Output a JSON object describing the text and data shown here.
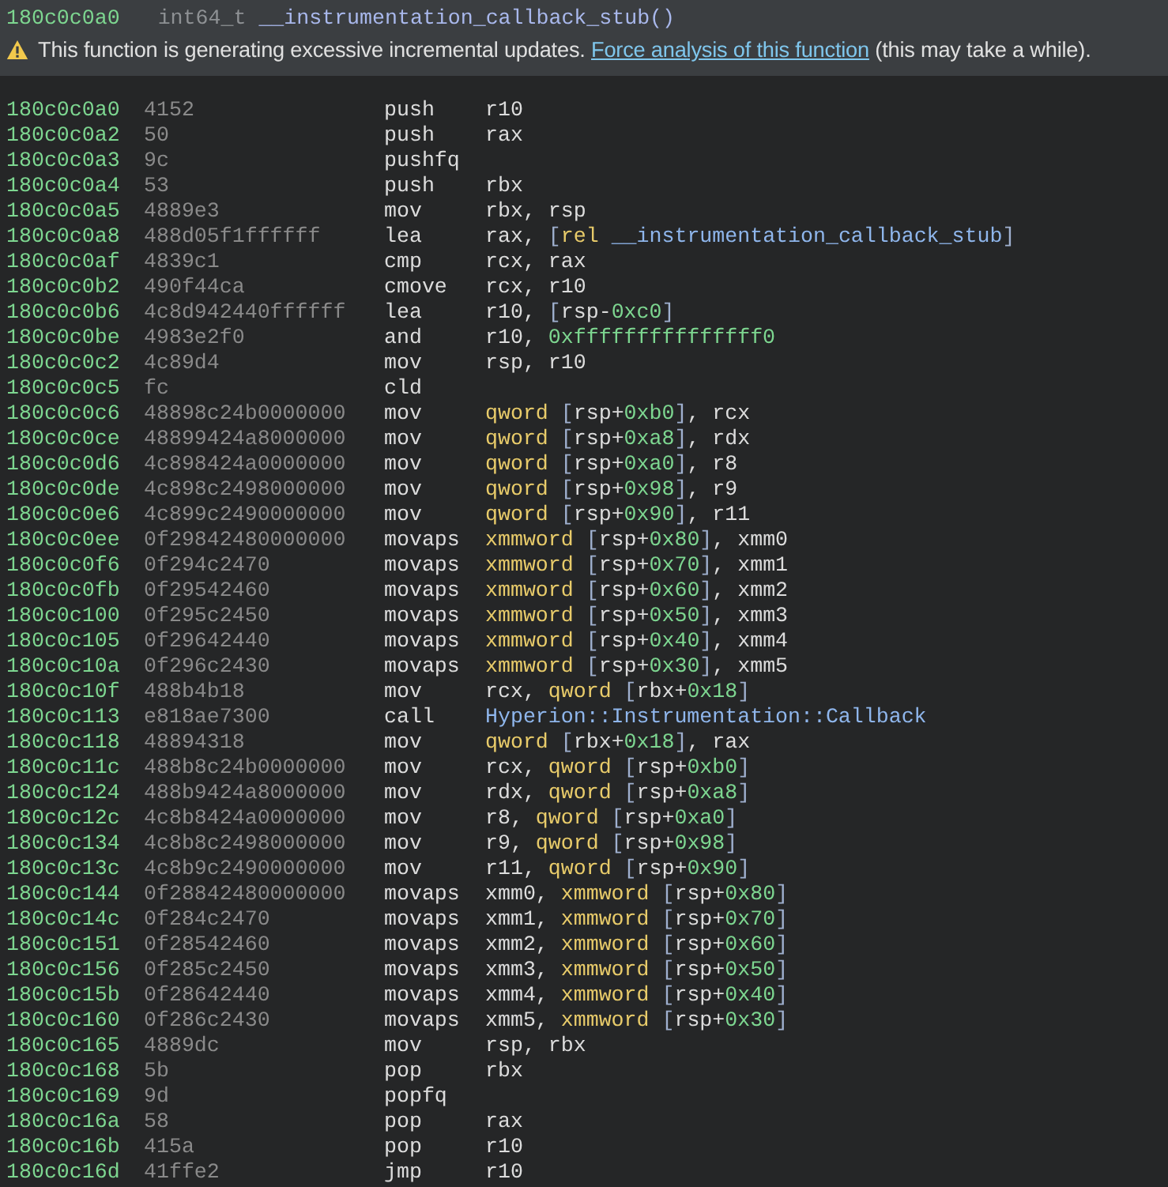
{
  "header": {
    "address": "180c0c0a0",
    "return_type": "int64_t",
    "function_name": "__instrumentation_callback_stub()"
  },
  "warning": {
    "before": "This function is generating excessive incremental updates. ",
    "link": "Force analysis of this function",
    "after": " (this may take a while)."
  },
  "instructions": [
    {
      "address": "180c0c0a0",
      "bytes": "4152",
      "mnemonic": "push",
      "operands": [
        {
          "kind": "reg",
          "text": "r10"
        }
      ]
    },
    {
      "address": "180c0c0a2",
      "bytes": "50",
      "mnemonic": "push",
      "operands": [
        {
          "kind": "reg",
          "text": "rax"
        }
      ]
    },
    {
      "address": "180c0c0a3",
      "bytes": "9c",
      "mnemonic": "pushfq"
    },
    {
      "address": "180c0c0a4",
      "bytes": "53",
      "mnemonic": "push",
      "operands": [
        {
          "kind": "reg",
          "text": "rbx"
        }
      ]
    },
    {
      "address": "180c0c0a5",
      "bytes": "4889e3",
      "mnemonic": "mov",
      "operands": [
        {
          "kind": "reg",
          "text": "rbx, rsp"
        }
      ]
    },
    {
      "address": "180c0c0a8",
      "bytes": "488d05f1ffffff",
      "mnemonic": "lea",
      "operands": [
        {
          "kind": "reg",
          "text": "rax, "
        },
        {
          "kind": "bracket",
          "text": "["
        },
        {
          "kind": "size",
          "text": "rel"
        },
        {
          "kind": "sym",
          "text": " __instrumentation_callback_stub"
        },
        {
          "kind": "bracket",
          "text": "]"
        }
      ]
    },
    {
      "address": "180c0c0af",
      "bytes": "4839c1",
      "mnemonic": "cmp",
      "operands": [
        {
          "kind": "reg",
          "text": "rcx, rax"
        }
      ]
    },
    {
      "address": "180c0c0b2",
      "bytes": "490f44ca",
      "mnemonic": "cmove",
      "operands": [
        {
          "kind": "reg",
          "text": "rcx, r10"
        }
      ]
    },
    {
      "address": "180c0c0b6",
      "bytes": "4c8d942440ffffff",
      "mnemonic": "lea",
      "operands": [
        {
          "kind": "reg",
          "text": "r10, "
        },
        {
          "kind": "bracket",
          "text": "["
        },
        {
          "kind": "reg",
          "text": "rsp-"
        },
        {
          "kind": "num",
          "text": "0xc0"
        },
        {
          "kind": "bracket",
          "text": "]"
        }
      ]
    },
    {
      "address": "180c0c0be",
      "bytes": "4983e2f0",
      "mnemonic": "and",
      "operands": [
        {
          "kind": "reg",
          "text": "r10, "
        },
        {
          "kind": "num",
          "text": "0xfffffffffffffff0"
        }
      ]
    },
    {
      "address": "180c0c0c2",
      "bytes": "4c89d4",
      "mnemonic": "mov",
      "operands": [
        {
          "kind": "reg",
          "text": "rsp, r10"
        }
      ]
    },
    {
      "address": "180c0c0c5",
      "bytes": "fc",
      "mnemonic": "cld"
    },
    {
      "address": "180c0c0c6",
      "bytes": "48898c24b0000000",
      "mnemonic": "mov",
      "operands": [
        {
          "kind": "size",
          "text": "qword"
        },
        {
          "kind": "bracket",
          "text": " ["
        },
        {
          "kind": "reg",
          "text": "rsp+"
        },
        {
          "kind": "num",
          "text": "0xb0"
        },
        {
          "kind": "bracket",
          "text": "]"
        },
        {
          "kind": "reg",
          "text": ", rcx"
        }
      ]
    },
    {
      "address": "180c0c0ce",
      "bytes": "48899424a8000000",
      "mnemonic": "mov",
      "operands": [
        {
          "kind": "size",
          "text": "qword"
        },
        {
          "kind": "bracket",
          "text": " ["
        },
        {
          "kind": "reg",
          "text": "rsp+"
        },
        {
          "kind": "num",
          "text": "0xa8"
        },
        {
          "kind": "bracket",
          "text": "]"
        },
        {
          "kind": "reg",
          "text": ", rdx"
        }
      ]
    },
    {
      "address": "180c0c0d6",
      "bytes": "4c898424a0000000",
      "mnemonic": "mov",
      "operands": [
        {
          "kind": "size",
          "text": "qword"
        },
        {
          "kind": "bracket",
          "text": " ["
        },
        {
          "kind": "reg",
          "text": "rsp+"
        },
        {
          "kind": "num",
          "text": "0xa0"
        },
        {
          "kind": "bracket",
          "text": "]"
        },
        {
          "kind": "reg",
          "text": ", r8"
        }
      ]
    },
    {
      "address": "180c0c0de",
      "bytes": "4c898c2498000000",
      "mnemonic": "mov",
      "operands": [
        {
          "kind": "size",
          "text": "qword"
        },
        {
          "kind": "bracket",
          "text": " ["
        },
        {
          "kind": "reg",
          "text": "rsp+"
        },
        {
          "kind": "num",
          "text": "0x98"
        },
        {
          "kind": "bracket",
          "text": "]"
        },
        {
          "kind": "reg",
          "text": ", r9"
        }
      ]
    },
    {
      "address": "180c0c0e6",
      "bytes": "4c899c2490000000",
      "mnemonic": "mov",
      "operands": [
        {
          "kind": "size",
          "text": "qword"
        },
        {
          "kind": "bracket",
          "text": " ["
        },
        {
          "kind": "reg",
          "text": "rsp+"
        },
        {
          "kind": "num",
          "text": "0x90"
        },
        {
          "kind": "bracket",
          "text": "]"
        },
        {
          "kind": "reg",
          "text": ", r11"
        }
      ]
    },
    {
      "address": "180c0c0ee",
      "bytes": "0f29842480000000",
      "mnemonic": "movaps",
      "operands": [
        {
          "kind": "size",
          "text": "xmmword"
        },
        {
          "kind": "bracket",
          "text": " ["
        },
        {
          "kind": "reg",
          "text": "rsp+"
        },
        {
          "kind": "num",
          "text": "0x80"
        },
        {
          "kind": "bracket",
          "text": "]"
        },
        {
          "kind": "reg",
          "text": ", xmm0"
        }
      ]
    },
    {
      "address": "180c0c0f6",
      "bytes": "0f294c2470",
      "mnemonic": "movaps",
      "operands": [
        {
          "kind": "size",
          "text": "xmmword"
        },
        {
          "kind": "bracket",
          "text": " ["
        },
        {
          "kind": "reg",
          "text": "rsp+"
        },
        {
          "kind": "num",
          "text": "0x70"
        },
        {
          "kind": "bracket",
          "text": "]"
        },
        {
          "kind": "reg",
          "text": ", xmm1"
        }
      ]
    },
    {
      "address": "180c0c0fb",
      "bytes": "0f29542460",
      "mnemonic": "movaps",
      "operands": [
        {
          "kind": "size",
          "text": "xmmword"
        },
        {
          "kind": "bracket",
          "text": " ["
        },
        {
          "kind": "reg",
          "text": "rsp+"
        },
        {
          "kind": "num",
          "text": "0x60"
        },
        {
          "kind": "bracket",
          "text": "]"
        },
        {
          "kind": "reg",
          "text": ", xmm2"
        }
      ]
    },
    {
      "address": "180c0c100",
      "bytes": "0f295c2450",
      "mnemonic": "movaps",
      "operands": [
        {
          "kind": "size",
          "text": "xmmword"
        },
        {
          "kind": "bracket",
          "text": " ["
        },
        {
          "kind": "reg",
          "text": "rsp+"
        },
        {
          "kind": "num",
          "text": "0x50"
        },
        {
          "kind": "bracket",
          "text": "]"
        },
        {
          "kind": "reg",
          "text": ", xmm3"
        }
      ]
    },
    {
      "address": "180c0c105",
      "bytes": "0f29642440",
      "mnemonic": "movaps",
      "operands": [
        {
          "kind": "size",
          "text": "xmmword"
        },
        {
          "kind": "bracket",
          "text": " ["
        },
        {
          "kind": "reg",
          "text": "rsp+"
        },
        {
          "kind": "num",
          "text": "0x40"
        },
        {
          "kind": "bracket",
          "text": "]"
        },
        {
          "kind": "reg",
          "text": ", xmm4"
        }
      ]
    },
    {
      "address": "180c0c10a",
      "bytes": "0f296c2430",
      "mnemonic": "movaps",
      "operands": [
        {
          "kind": "size",
          "text": "xmmword"
        },
        {
          "kind": "bracket",
          "text": " ["
        },
        {
          "kind": "reg",
          "text": "rsp+"
        },
        {
          "kind": "num",
          "text": "0x30"
        },
        {
          "kind": "bracket",
          "text": "]"
        },
        {
          "kind": "reg",
          "text": ", xmm5"
        }
      ]
    },
    {
      "address": "180c0c10f",
      "bytes": "488b4b18",
      "mnemonic": "mov",
      "operands": [
        {
          "kind": "reg",
          "text": "rcx, "
        },
        {
          "kind": "size",
          "text": "qword"
        },
        {
          "kind": "bracket",
          "text": " ["
        },
        {
          "kind": "reg",
          "text": "rbx+"
        },
        {
          "kind": "num",
          "text": "0x18"
        },
        {
          "kind": "bracket",
          "text": "]"
        }
      ]
    },
    {
      "address": "180c0c113",
      "bytes": "e818ae7300",
      "mnemonic": "call",
      "operands": [
        {
          "kind": "sym",
          "text": "Hyperion::Instrumentation::Callback"
        }
      ]
    },
    {
      "address": "180c0c118",
      "bytes": "48894318",
      "mnemonic": "mov",
      "operands": [
        {
          "kind": "size",
          "text": "qword"
        },
        {
          "kind": "bracket",
          "text": " ["
        },
        {
          "kind": "reg",
          "text": "rbx+"
        },
        {
          "kind": "num",
          "text": "0x18"
        },
        {
          "kind": "bracket",
          "text": "]"
        },
        {
          "kind": "reg",
          "text": ", rax"
        }
      ]
    },
    {
      "address": "180c0c11c",
      "bytes": "488b8c24b0000000",
      "mnemonic": "mov",
      "operands": [
        {
          "kind": "reg",
          "text": "rcx, "
        },
        {
          "kind": "size",
          "text": "qword"
        },
        {
          "kind": "bracket",
          "text": " ["
        },
        {
          "kind": "reg",
          "text": "rsp+"
        },
        {
          "kind": "num",
          "text": "0xb0"
        },
        {
          "kind": "bracket",
          "text": "]"
        }
      ]
    },
    {
      "address": "180c0c124",
      "bytes": "488b9424a8000000",
      "mnemonic": "mov",
      "operands": [
        {
          "kind": "reg",
          "text": "rdx, "
        },
        {
          "kind": "size",
          "text": "qword"
        },
        {
          "kind": "bracket",
          "text": " ["
        },
        {
          "kind": "reg",
          "text": "rsp+"
        },
        {
          "kind": "num",
          "text": "0xa8"
        },
        {
          "kind": "bracket",
          "text": "]"
        }
      ]
    },
    {
      "address": "180c0c12c",
      "bytes": "4c8b8424a0000000",
      "mnemonic": "mov",
      "operands": [
        {
          "kind": "reg",
          "text": "r8, "
        },
        {
          "kind": "size",
          "text": "qword"
        },
        {
          "kind": "bracket",
          "text": " ["
        },
        {
          "kind": "reg",
          "text": "rsp+"
        },
        {
          "kind": "num",
          "text": "0xa0"
        },
        {
          "kind": "bracket",
          "text": "]"
        }
      ]
    },
    {
      "address": "180c0c134",
      "bytes": "4c8b8c2498000000",
      "mnemonic": "mov",
      "operands": [
        {
          "kind": "reg",
          "text": "r9, "
        },
        {
          "kind": "size",
          "text": "qword"
        },
        {
          "kind": "bracket",
          "text": " ["
        },
        {
          "kind": "reg",
          "text": "rsp+"
        },
        {
          "kind": "num",
          "text": "0x98"
        },
        {
          "kind": "bracket",
          "text": "]"
        }
      ]
    },
    {
      "address": "180c0c13c",
      "bytes": "4c8b9c2490000000",
      "mnemonic": "mov",
      "operands": [
        {
          "kind": "reg",
          "text": "r11, "
        },
        {
          "kind": "size",
          "text": "qword"
        },
        {
          "kind": "bracket",
          "text": " ["
        },
        {
          "kind": "reg",
          "text": "rsp+"
        },
        {
          "kind": "num",
          "text": "0x90"
        },
        {
          "kind": "bracket",
          "text": "]"
        }
      ]
    },
    {
      "address": "180c0c144",
      "bytes": "0f28842480000000",
      "mnemonic": "movaps",
      "operands": [
        {
          "kind": "reg",
          "text": "xmm0, "
        },
        {
          "kind": "size",
          "text": "xmmword"
        },
        {
          "kind": "bracket",
          "text": " ["
        },
        {
          "kind": "reg",
          "text": "rsp+"
        },
        {
          "kind": "num",
          "text": "0x80"
        },
        {
          "kind": "bracket",
          "text": "]"
        }
      ]
    },
    {
      "address": "180c0c14c",
      "bytes": "0f284c2470",
      "mnemonic": "movaps",
      "operands": [
        {
          "kind": "reg",
          "text": "xmm1, "
        },
        {
          "kind": "size",
          "text": "xmmword"
        },
        {
          "kind": "bracket",
          "text": " ["
        },
        {
          "kind": "reg",
          "text": "rsp+"
        },
        {
          "kind": "num",
          "text": "0x70"
        },
        {
          "kind": "bracket",
          "text": "]"
        }
      ]
    },
    {
      "address": "180c0c151",
      "bytes": "0f28542460",
      "mnemonic": "movaps",
      "operands": [
        {
          "kind": "reg",
          "text": "xmm2, "
        },
        {
          "kind": "size",
          "text": "xmmword"
        },
        {
          "kind": "bracket",
          "text": " ["
        },
        {
          "kind": "reg",
          "text": "rsp+"
        },
        {
          "kind": "num",
          "text": "0x60"
        },
        {
          "kind": "bracket",
          "text": "]"
        }
      ]
    },
    {
      "address": "180c0c156",
      "bytes": "0f285c2450",
      "mnemonic": "movaps",
      "operands": [
        {
          "kind": "reg",
          "text": "xmm3, "
        },
        {
          "kind": "size",
          "text": "xmmword"
        },
        {
          "kind": "bracket",
          "text": " ["
        },
        {
          "kind": "reg",
          "text": "rsp+"
        },
        {
          "kind": "num",
          "text": "0x50"
        },
        {
          "kind": "bracket",
          "text": "]"
        }
      ]
    },
    {
      "address": "180c0c15b",
      "bytes": "0f28642440",
      "mnemonic": "movaps",
      "operands": [
        {
          "kind": "reg",
          "text": "xmm4, "
        },
        {
          "kind": "size",
          "text": "xmmword"
        },
        {
          "kind": "bracket",
          "text": " ["
        },
        {
          "kind": "reg",
          "text": "rsp+"
        },
        {
          "kind": "num",
          "text": "0x40"
        },
        {
          "kind": "bracket",
          "text": "]"
        }
      ]
    },
    {
      "address": "180c0c160",
      "bytes": "0f286c2430",
      "mnemonic": "movaps",
      "operands": [
        {
          "kind": "reg",
          "text": "xmm5, "
        },
        {
          "kind": "size",
          "text": "xmmword"
        },
        {
          "kind": "bracket",
          "text": " ["
        },
        {
          "kind": "reg",
          "text": "rsp+"
        },
        {
          "kind": "num",
          "text": "0x30"
        },
        {
          "kind": "bracket",
          "text": "]"
        }
      ]
    },
    {
      "address": "180c0c165",
      "bytes": "4889dc",
      "mnemonic": "mov",
      "operands": [
        {
          "kind": "reg",
          "text": "rsp, rbx"
        }
      ]
    },
    {
      "address": "180c0c168",
      "bytes": "5b",
      "mnemonic": "pop",
      "operands": [
        {
          "kind": "reg",
          "text": "rbx"
        }
      ]
    },
    {
      "address": "180c0c169",
      "bytes": "9d",
      "mnemonic": "popfq"
    },
    {
      "address": "180c0c16a",
      "bytes": "58",
      "mnemonic": "pop",
      "operands": [
        {
          "kind": "reg",
          "text": "rax"
        }
      ]
    },
    {
      "address": "180c0c16b",
      "bytes": "415a",
      "mnemonic": "pop",
      "operands": [
        {
          "kind": "reg",
          "text": "r10"
        }
      ]
    },
    {
      "address": "180c0c16d",
      "bytes": "41ffe2",
      "mnemonic": "jmp",
      "operands": [
        {
          "kind": "reg",
          "text": "r10"
        }
      ]
    }
  ]
}
